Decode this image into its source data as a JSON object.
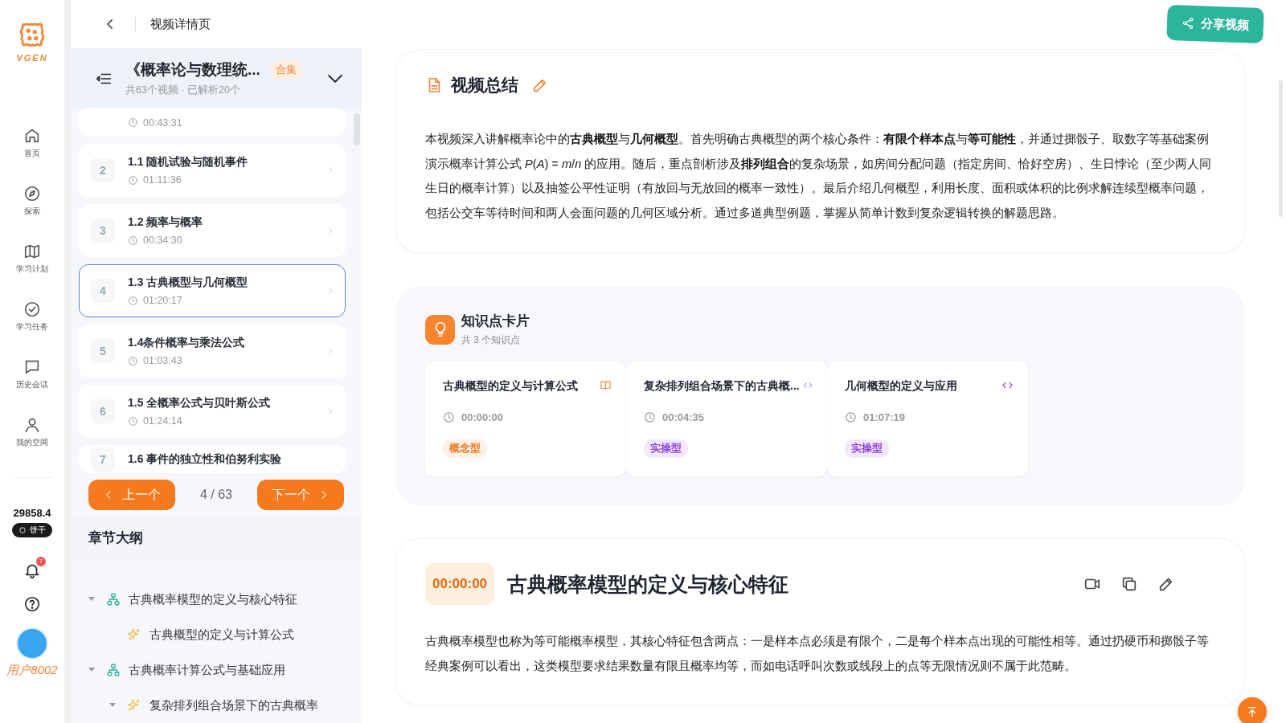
{
  "topbar": {
    "title": "视频详情页",
    "share_button": "分享视频"
  },
  "nav": {
    "logo": "VGEN",
    "items": [
      {
        "kind": "home",
        "label": "首页",
        "selected": false
      },
      {
        "kind": "compass",
        "label": "探索",
        "selected": false
      },
      {
        "kind": "map",
        "label": "学习计划",
        "selected": false
      },
      {
        "kind": "check",
        "label": "学习任务",
        "selected": false
      },
      {
        "kind": "chat",
        "label": "历史会话",
        "selected": false
      },
      {
        "kind": "user",
        "label": "我的空间",
        "selected": false
      }
    ],
    "points": "29858.4",
    "currency": "饼干",
    "notifications": "7",
    "user": "用户8002"
  },
  "playlist": {
    "title": "《概率论与数理统...",
    "badge": "合集",
    "meta": "共63个视频 · 已解析20个",
    "videos": [
      {
        "time": "00:43:31",
        "selected": false
      },
      {
        "number": "2",
        "title": "1.1 随机试验与随机事件",
        "time": "01:11:36",
        "selected": false
      },
      {
        "number": "3",
        "title": "1.2 频率与概率",
        "time": "00:34:30",
        "selected": false
      },
      {
        "number": "4",
        "title": "1.3 古典概型与几何概型",
        "time": "01:20:17",
        "selected": true
      },
      {
        "number": "5",
        "title": "1.4条件概率与乘法公式",
        "time": "01:03:43",
        "selected": false
      },
      {
        "number": "6",
        "title": "1.5 全概率公式与贝叶斯公式",
        "time": "01:24:14",
        "selected": false
      },
      {
        "number": "7",
        "title": "1.6 事件的独立性和伯努利实验",
        "selected": false
      }
    ]
  },
  "pager": {
    "prev": "上一个",
    "position": "4 / 63",
    "next": "下一个"
  },
  "outline": {
    "title": "章节大纲",
    "items": [
      {
        "kind": "topic",
        "label": "古典概率模型的定义与核心特征",
        "expanded": true,
        "children": [
          {
            "kind": "point",
            "label": "古典概型的定义与计算公式"
          }
        ]
      },
      {
        "kind": "topic",
        "label": "古典概率计算公式与基础应用",
        "expanded": true,
        "children": [
          {
            "kind": "point",
            "label": "复杂排列组合场景下的古典概率",
            "expanded": true
          }
        ]
      }
    ]
  },
  "summary": {
    "title": "视频总结",
    "text": "本视频深入讲解概率论中的**古典概型**与**几何概型**。首先明确古典概型的两个核心条件：**有限个样本点**与**等可能性**，并通过掷骰子、取数字等基础案例演示概率计算公式 *P*(*A*) = *m*/*n* 的应用。随后，重点剖析涉及**排列组合**的复杂场景，如房间分配问题（指定房间、恰好空房）、生日悖论（至少两人同生日的概率计算）以及抽签公平性证明（有放回与无放回的概率一致性）。最后介绍几何概型，利用长度、面积或体积的比例求解连续型概率问题，包括公交车等待时间和两人会面问题的几何区域分析。通过多道典型例题，掌握从简单计数到复杂逻辑转换的解题思路。"
  },
  "knowledge": {
    "title": "知识点卡片",
    "count": "共 3 个知识点",
    "cards": [
      {
        "kind": "concept",
        "title": "古典概型的定义与计算公式",
        "time": "00:00:00",
        "tag": "概念型"
      },
      {
        "kind": "practice",
        "title": "复杂排列组合场景下的古典概...",
        "time": "00:04:35",
        "tag": "实操型"
      },
      {
        "kind": "practice",
        "title": "几何概型的定义与应用",
        "time": "01:07:19",
        "tag": "实操型"
      }
    ]
  },
  "section": {
    "time": "00:00:00",
    "title": "古典概率模型的定义与核心特征",
    "text": "古典概率模型也称为等可能概率模型，其核心特征包含两点：一是样本点必须是有限个，二是每个样本点出现的可能性相等。通过扔硬币和掷骰子等经典案例可以看出，这类模型要求结果数量有限且概率均等，而如电话呼叫次数或线段上的点等无限情况则不属于此范畴。"
  }
}
